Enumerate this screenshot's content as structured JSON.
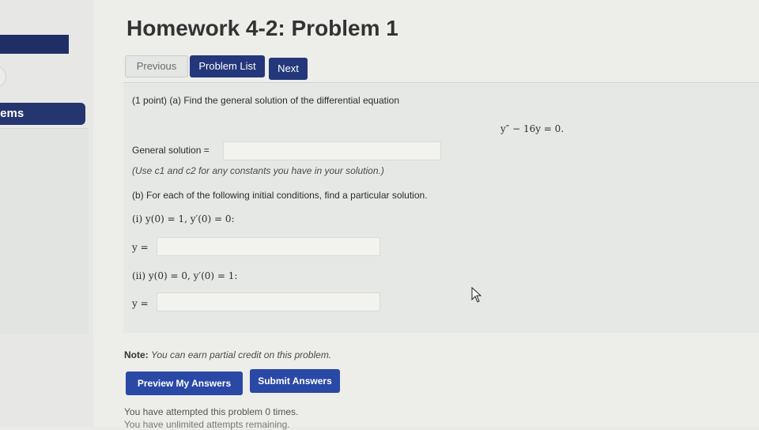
{
  "sidebar": {
    "problems_label": "lems"
  },
  "header": {
    "title": "Homework 4-2: Problem 1"
  },
  "nav": {
    "previous": "Previous",
    "problem_list": "Problem List",
    "next": "Next"
  },
  "problem": {
    "intro": "(1 point) (a) Find the general solution of the differential equation",
    "equation": "y″ − 16y = 0.",
    "general_solution_label": "General solution =",
    "general_solution_value": "",
    "constants_hint": "(Use c1 and c2 for any constants you have in your solution.)",
    "part_b": "(b) For each of the following initial conditions, find a particular solution.",
    "condition_i": "(i) y(0) = 1, y′(0) = 0:",
    "condition_ii": "(ii) y(0) = 0, y′(0) = 1:",
    "y_label": "y =",
    "answer_i_value": "",
    "answer_ii_value": ""
  },
  "footer": {
    "note_label": "Note:",
    "note_text": "You can earn partial credit on this problem.",
    "preview_button": "Preview My Answers",
    "submit_button": "Submit Answers",
    "attempts_text": "You have attempted this problem 0 times.",
    "remaining_text": "You have unlimited attempts remaining."
  }
}
